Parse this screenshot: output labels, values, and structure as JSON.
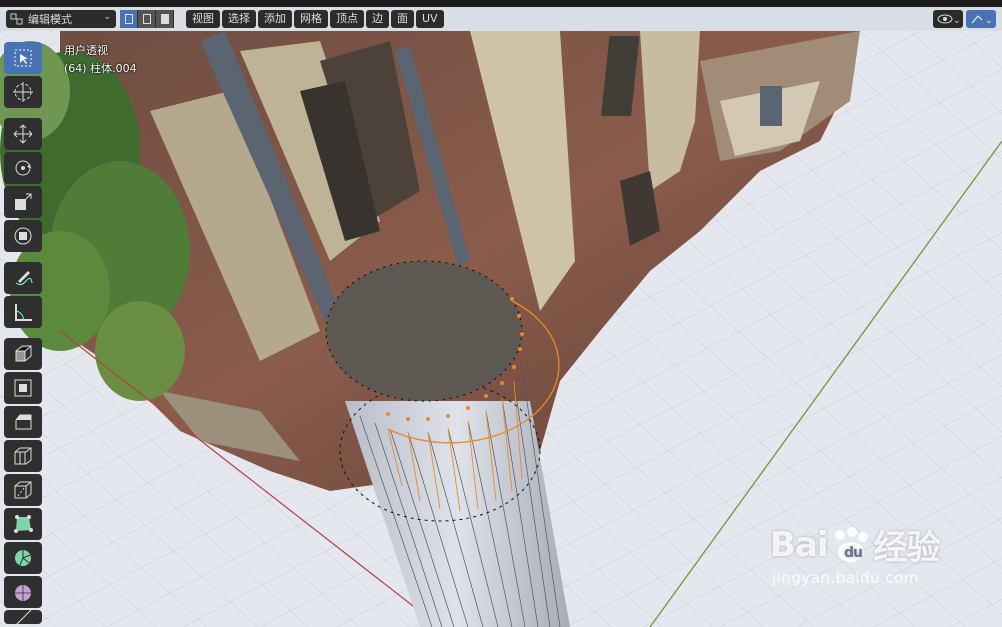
{
  "header": {
    "mode": "编辑模式",
    "menus": [
      "视图",
      "选择",
      "添加",
      "网格",
      "顶点",
      "边",
      "面",
      "UV"
    ]
  },
  "viewport": {
    "view_name": "用户透视",
    "object_info": "(64) 柱体.004"
  },
  "toolbar": {
    "tools": [
      "select-box",
      "cursor",
      "move",
      "rotate",
      "scale",
      "transform",
      "annotate",
      "measure",
      "extrude-region",
      "inset-faces",
      "bevel",
      "loop-cut",
      "knife",
      "poly-build",
      "spin",
      "smooth",
      "shrink-fatten"
    ]
  },
  "watermark": {
    "brand": "Bai",
    "brand_suffix": "经验",
    "url": "jingyan.baidu.com"
  },
  "colors": {
    "header_bg": "#1d1d1d",
    "widget_bg": "#2b2b2b",
    "active_blue": "#4772b3",
    "x_axis": "#b5413d",
    "y_axis": "#6a9a3a",
    "selected_orange": "#e88a2a",
    "face_top": "#5e5852"
  }
}
